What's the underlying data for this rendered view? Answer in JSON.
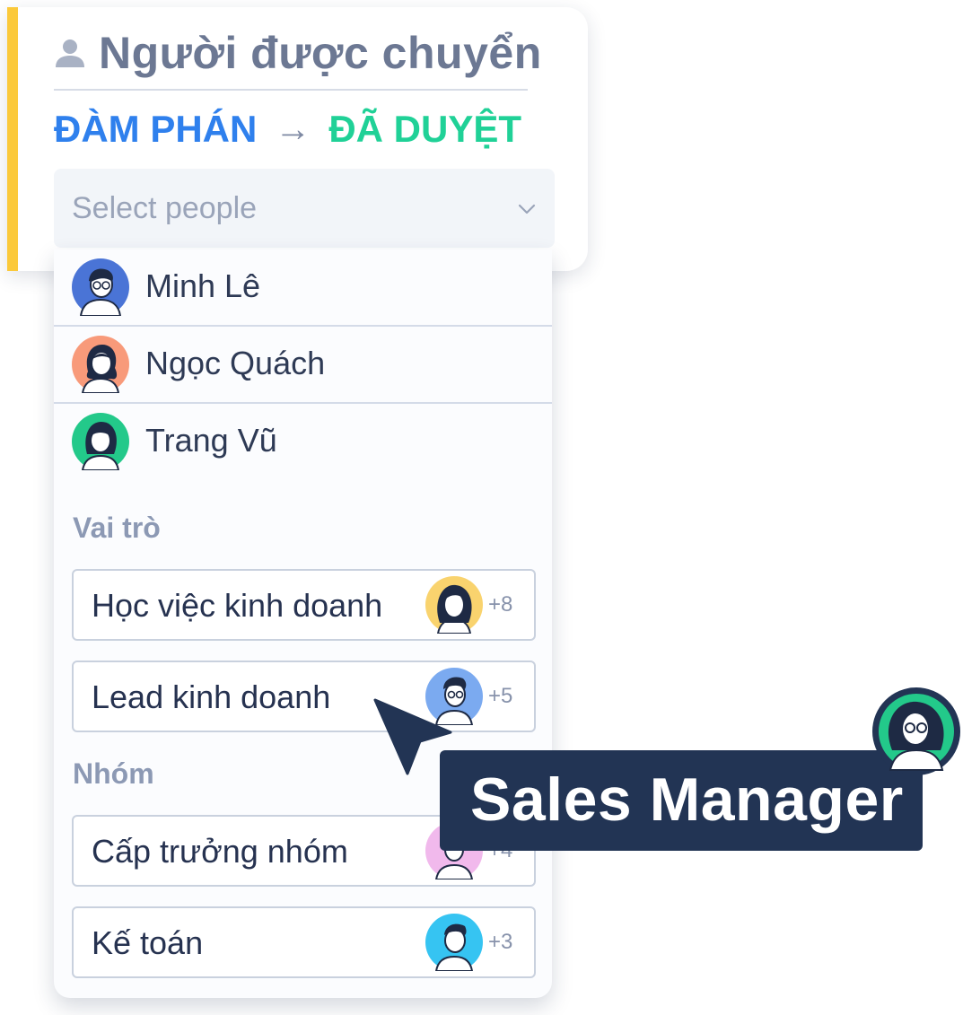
{
  "header": {
    "title": "Người được chuyển",
    "icon": "person-icon",
    "accent_color": "#FBC93A"
  },
  "transition": {
    "from": "ĐÀM PHÁN",
    "arrow": "→",
    "to": "ĐÃ DUYỆT",
    "from_color": "#2F80ED",
    "to_color": "#20D197"
  },
  "select": {
    "placeholder": "Select people"
  },
  "people": [
    {
      "name": "Minh Lê",
      "avatar_color": "#4A74D6"
    },
    {
      "name": "Ngọc Quách",
      "avatar_color": "#F89A7A"
    },
    {
      "name": "Trang Vũ",
      "avatar_color": "#23C98A"
    }
  ],
  "roles": {
    "label": "Vai trò",
    "items": [
      {
        "label": "Học việc kinh doanh",
        "count": "+8",
        "avatar_color": "#F9D36E"
      },
      {
        "label": "Lead kinh doanh",
        "count": "+5",
        "avatar_color": "#7BAAF0"
      }
    ]
  },
  "groups": {
    "label": "Nhóm",
    "items": [
      {
        "label": "Cấp trưởng nhóm",
        "count": "+4",
        "avatar_color": "#F1B9EC"
      },
      {
        "label": "Kế toán",
        "count": "+3",
        "avatar_color": "#36C4F2"
      }
    ]
  },
  "tooltip": {
    "label": "Sales Manager",
    "avatar_color": "#23C98A"
  }
}
